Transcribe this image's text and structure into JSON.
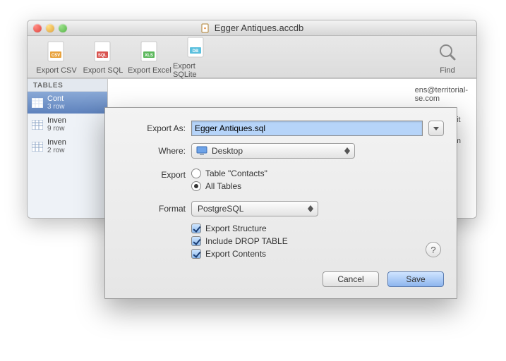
{
  "window": {
    "title": "Egger Antiques.accdb"
  },
  "toolbar": {
    "items": [
      {
        "label": "Export CSV",
        "icon": "csv"
      },
      {
        "label": "Export SQL",
        "icon": "sql"
      },
      {
        "label": "Export Excel",
        "icon": "xls"
      },
      {
        "label": "Export SQLite",
        "icon": "db"
      }
    ],
    "find_label": "Find"
  },
  "sidebar": {
    "header": "TABLES",
    "items": [
      {
        "name": "Cont",
        "rows": "3 row"
      },
      {
        "name": "Inven",
        "rows": "9 row"
      },
      {
        "name": "Inven",
        "rows": "2 row"
      }
    ]
  },
  "grid": {
    "emails": [
      "ens@territorial-",
      "se.com",
      "@imperium.it",
      "acebook.com"
    ]
  },
  "dialog": {
    "export_as_label": "Export As:",
    "export_as_value": "Egger Antiques.sql",
    "where_label": "Where:",
    "where_value": "Desktop",
    "export_label": "Export",
    "radio_table_label": "Table \"Contacts\"",
    "radio_all_label": "All Tables",
    "format_label": "Format",
    "format_value": "PostgreSQL",
    "check_structure": "Export Structure",
    "check_drop": "Include DROP TABLE",
    "check_contents": "Export Contents",
    "help": "?",
    "cancel": "Cancel",
    "save": "Save"
  }
}
